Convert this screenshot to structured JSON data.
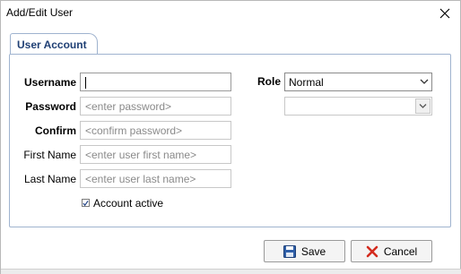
{
  "window": {
    "title": "Add/Edit User"
  },
  "tab": {
    "label": "User Account"
  },
  "form": {
    "username": {
      "label": "Username",
      "value": ""
    },
    "password": {
      "label": "Password",
      "placeholder": "<enter password>"
    },
    "confirm": {
      "label": "Confirm",
      "placeholder": "<confirm password>"
    },
    "first_name": {
      "label": "First Name",
      "placeholder": "<enter user first name>"
    },
    "last_name": {
      "label": "Last Name",
      "placeholder": "<enter user last name>"
    },
    "role": {
      "label": "Role",
      "value": "Normal"
    },
    "secondary_select": {
      "value": ""
    },
    "account_active": {
      "label": "Account active",
      "checked": true
    }
  },
  "buttons": {
    "save": "Save",
    "cancel": "Cancel"
  },
  "colors": {
    "tab_text": "#1f3f74",
    "panel_border": "#9fb3cf",
    "cancel_icon": "#d42b1e",
    "save_icon": "#2f5fa8"
  },
  "icons": {
    "close": "close-icon",
    "save": "floppy-disk-icon",
    "cancel": "red-x-icon",
    "dropdown": "chevron-down-icon",
    "check": "checkmark-icon"
  }
}
